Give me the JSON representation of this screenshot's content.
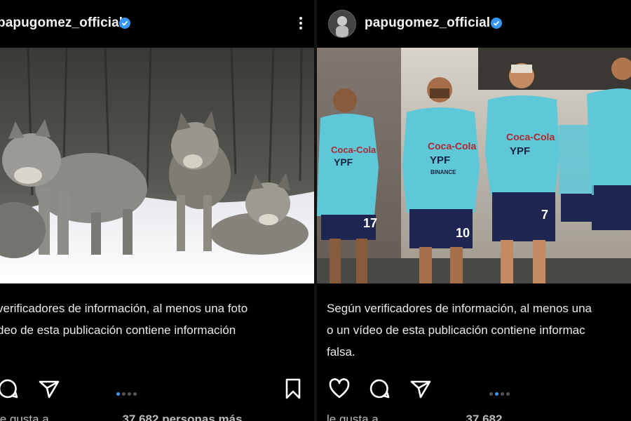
{
  "left_post": {
    "username": "papugomez_official",
    "caption_lines": [
      "verificadores de información, al menos una foto",
      "deo de esta publicación contiene información"
    ],
    "likes_left": "le gusta a",
    "likes_count": "37.682 personas más"
  },
  "right_post": {
    "username": "papugomez_official",
    "caption_lines": [
      "Según verificadores de información, al menos una",
      "o un vídeo de esta publicación contiene informac",
      "falsa."
    ],
    "likes_left": "le gusta a",
    "likes_count": "37.682"
  },
  "jerseys": {
    "sponsor1": "Coca-Cola",
    "sponsor2": "YPF",
    "sponsor3": "BINANCE",
    "numbers": [
      "17",
      "10",
      "7"
    ]
  },
  "colors": {
    "background": "#000000",
    "verified": "#3797f0",
    "jersey": "#5ec8d8",
    "shorts": "#1d2550"
  },
  "icons": [
    "verified-badge-icon",
    "more-options-icon",
    "heart-icon",
    "comment-icon",
    "share-icon",
    "bookmark-icon"
  ]
}
